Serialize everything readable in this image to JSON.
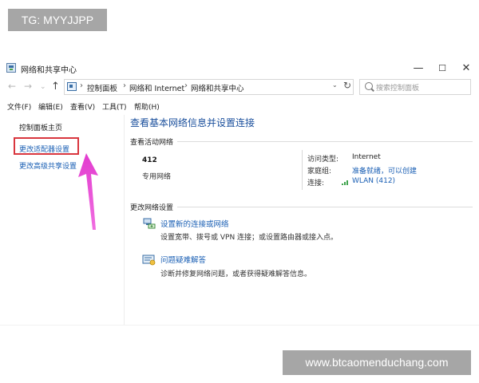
{
  "watermarks": {
    "top": "TG: MYYJJPP",
    "bottom": "www.btcaomenduchang.com"
  },
  "window": {
    "title": "网络和共享中心",
    "icon": "network-center-icon",
    "controls": {
      "minimize": "—",
      "maximize": "☐",
      "close": "✕"
    }
  },
  "nav": {
    "back": "←",
    "forward": "→",
    "recent": "⌄",
    "up": "↑",
    "breadcrumbs": [
      "控制面板",
      "网络和 Internet",
      "网络和共享中心"
    ],
    "separator": "›",
    "dropdown": "⌄",
    "refresh": "↻",
    "search_placeholder": "搜索控制面板"
  },
  "menu": [
    "文件(F)",
    "编辑(E)",
    "查看(V)",
    "工具(T)",
    "帮助(H)"
  ],
  "sidebar": {
    "home": "控制面板主页",
    "items": [
      "更改适配器设置",
      "更改高级共享设置"
    ]
  },
  "main": {
    "heading": "查看基本网络信息并设置连接",
    "active_section": "查看活动网络",
    "network": {
      "name": "412",
      "type": "专用网络"
    },
    "info": [
      {
        "label": "访问类型:",
        "value": "Internet"
      },
      {
        "label": "家庭组:",
        "value": "准备就绪，可以创建"
      },
      {
        "label": "连接:",
        "value": "WLAN (412)"
      }
    ],
    "change_section": "更改网络设置",
    "tasks": [
      {
        "link": "设置新的连接或网络",
        "desc": "设置宽带、拨号或 VPN 连接；或设置路由器或接入点。",
        "icon": "new-connection-icon"
      },
      {
        "link": "问题疑难解答",
        "desc": "诊断并修复网络问题，或者获得疑难解答信息。",
        "icon": "troubleshoot-icon"
      }
    ]
  },
  "colors": {
    "link": "#1a5fb4",
    "heading": "#1a4f9c",
    "highlight": "#d9363e",
    "arrow": "#e23ccf",
    "watermark_bg": "#a6a6a6"
  }
}
